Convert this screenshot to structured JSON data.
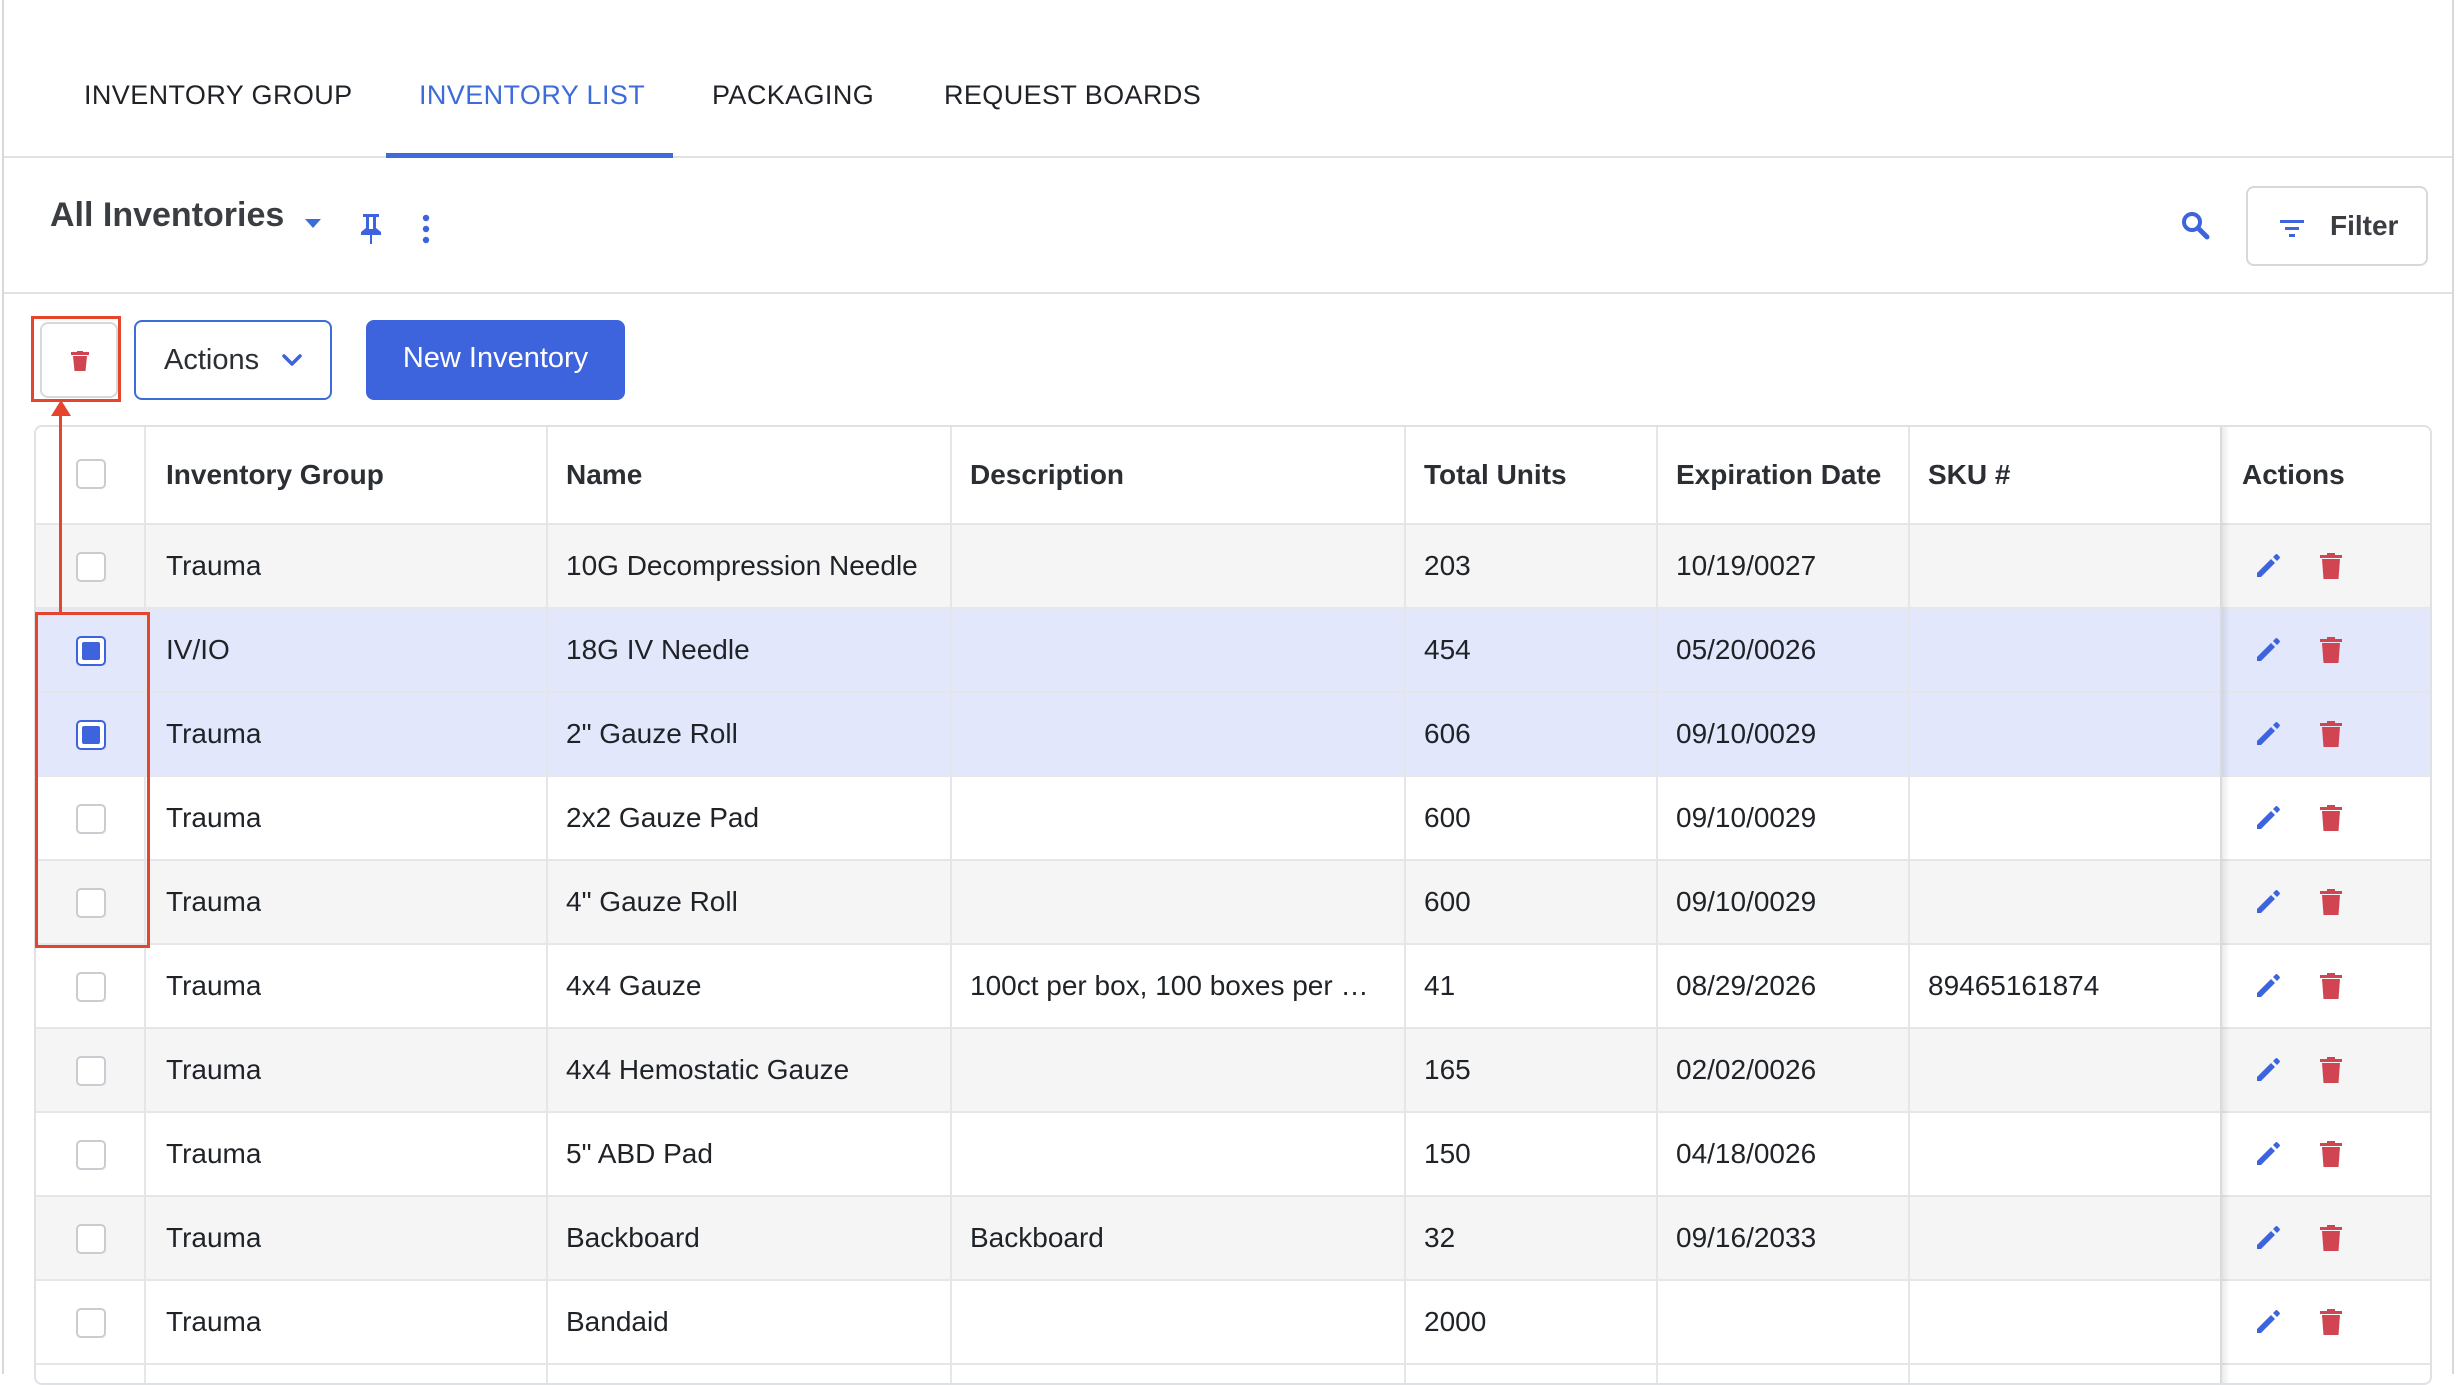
{
  "tabs": [
    {
      "label": "INVENTORY GROUP",
      "active": false
    },
    {
      "label": "INVENTORY LIST",
      "active": true
    },
    {
      "label": "PACKAGING",
      "active": false
    },
    {
      "label": "REQUEST BOARDS",
      "active": false
    }
  ],
  "toolbar": {
    "view_title": "All Inventories",
    "filter_label": "Filter"
  },
  "actions": {
    "actions_label": "Actions",
    "new_label": "New Inventory"
  },
  "table": {
    "columns": [
      "Inventory Group",
      "Name",
      "Description",
      "Total Units",
      "Expiration Date",
      "SKU #",
      "Actions"
    ],
    "rows": [
      {
        "group": "Trauma",
        "name": "10G Decompression Needle",
        "description": "",
        "units": "203",
        "expiration": "10/19/0027",
        "sku": "",
        "checked": false
      },
      {
        "group": "IV/IO",
        "name": "18G IV Needle",
        "description": "",
        "units": "454",
        "expiration": "05/20/0026",
        "sku": "",
        "checked": true
      },
      {
        "group": "Trauma",
        "name": "2\" Gauze Roll",
        "description": "",
        "units": "606",
        "expiration": "09/10/0029",
        "sku": "",
        "checked": true
      },
      {
        "group": "Trauma",
        "name": "2x2 Gauze Pad",
        "description": "",
        "units": "600",
        "expiration": "09/10/0029",
        "sku": "",
        "checked": false
      },
      {
        "group": "Trauma",
        "name": "4\" Gauze Roll",
        "description": "",
        "units": "600",
        "expiration": "09/10/0029",
        "sku": "",
        "checked": false
      },
      {
        "group": "Trauma",
        "name": "4x4 Gauze",
        "description": "100ct per box, 100 boxes per …",
        "units": "41",
        "expiration": "08/29/2026",
        "sku": "89465161874",
        "checked": false
      },
      {
        "group": "Trauma",
        "name": "4x4 Hemostatic Gauze",
        "description": "",
        "units": "165",
        "expiration": "02/02/0026",
        "sku": "",
        "checked": false
      },
      {
        "group": "Trauma",
        "name": "5\" ABD Pad",
        "description": "",
        "units": "150",
        "expiration": "04/18/0026",
        "sku": "",
        "checked": false
      },
      {
        "group": "Trauma",
        "name": "Backboard",
        "description": "Backboard",
        "units": "32",
        "expiration": "09/16/2033",
        "sku": "",
        "checked": false
      },
      {
        "group": "Trauma",
        "name": "Bandaid",
        "description": "",
        "units": "2000",
        "expiration": "",
        "sku": "",
        "checked": false
      }
    ]
  },
  "colors": {
    "accent": "#3d6bd9",
    "primary_button": "#3d63dd",
    "delete_red": "#d14452",
    "annotation": "#e5442d",
    "selected_row": "#e2e7fb"
  }
}
